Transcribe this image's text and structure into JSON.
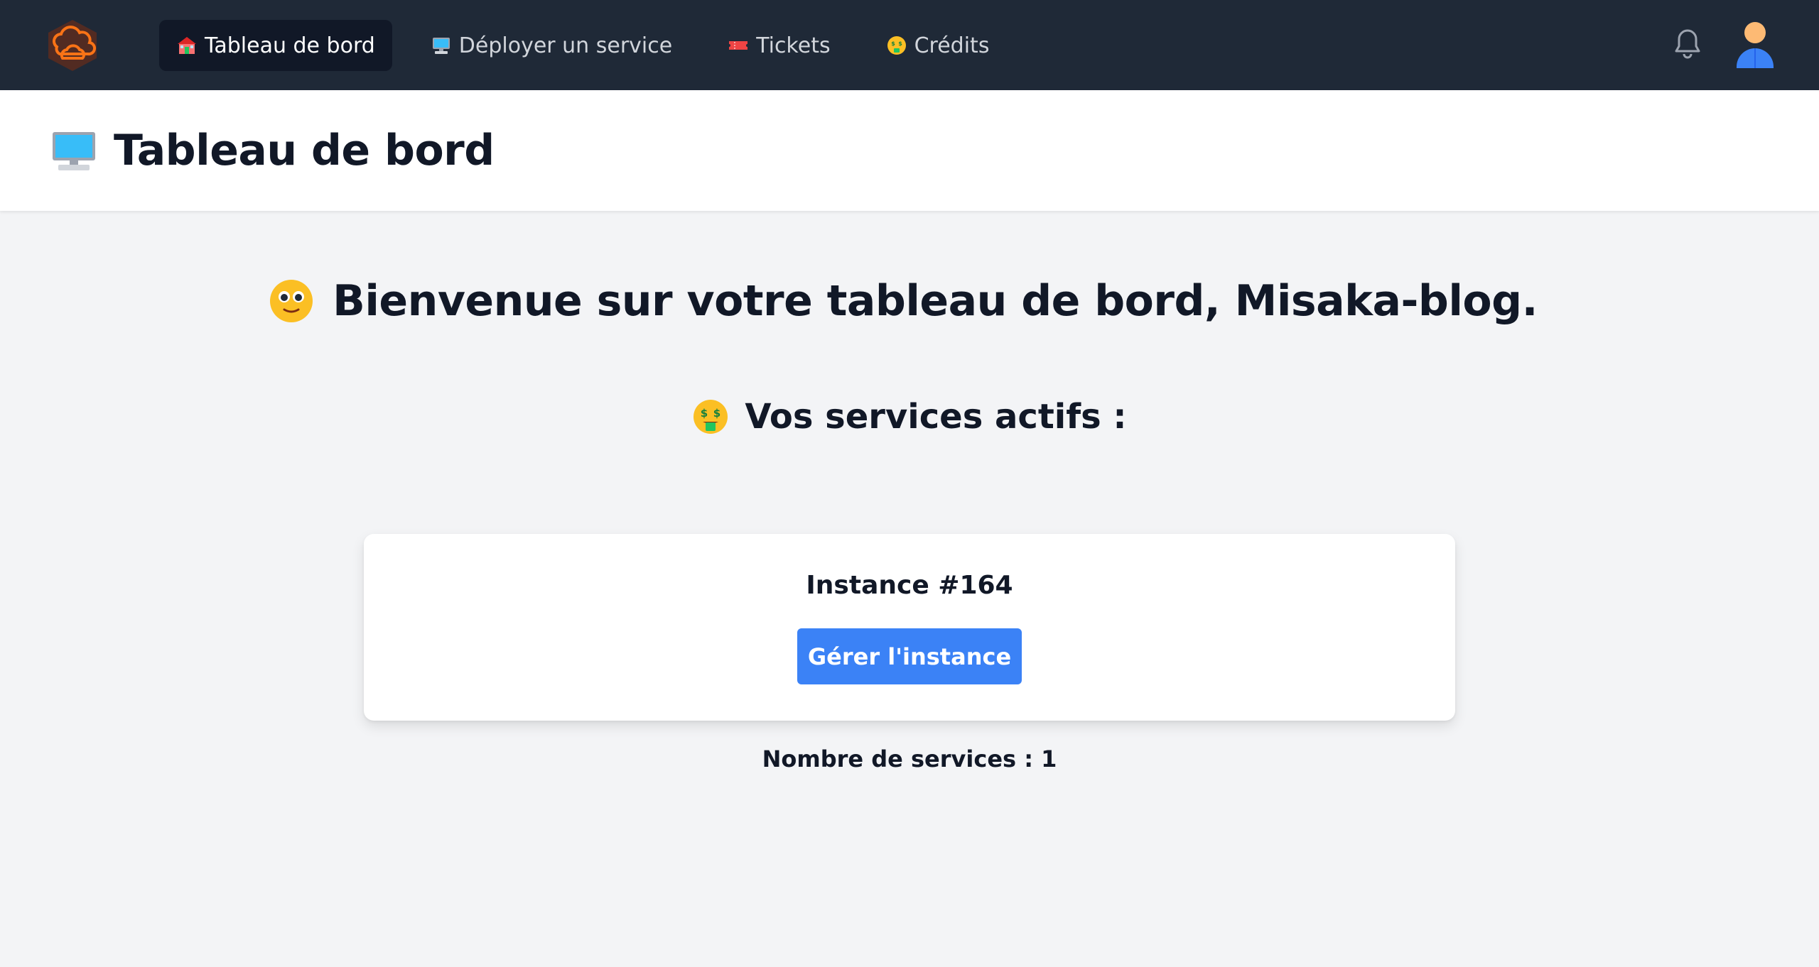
{
  "nav": {
    "logo_icon": "cloud-logo-icon",
    "items": [
      {
        "label": "Tableau de bord",
        "icon": "house-icon",
        "active": true
      },
      {
        "label": "Déployer un service",
        "icon": "computer-icon",
        "active": false
      },
      {
        "label": "Tickets",
        "icon": "ticket-icon",
        "active": false
      },
      {
        "label": "Crédits",
        "icon": "money-face-icon",
        "active": false
      }
    ],
    "notification_icon": "bell-icon",
    "avatar_icon": "user-avatar-icon"
  },
  "header": {
    "icon": "computer-icon",
    "title": "Tableau de bord"
  },
  "main": {
    "welcome_icon": "smiley-icon",
    "welcome_text": "Bienvenue sur votre tableau de bord, Misaka-blog.",
    "services_icon": "money-face-icon",
    "services_heading": "Vos services actifs :",
    "instances": [
      {
        "title": "Instance #164",
        "button_label": "Gérer l'instance"
      }
    ],
    "service_count_text": "Nombre de services : 1"
  },
  "colors": {
    "nav_bg": "#1f2937",
    "nav_active_bg": "#111827",
    "page_bg": "#f3f4f6",
    "button_blue": "#3b82f6",
    "logo_orange": "#f97316"
  }
}
